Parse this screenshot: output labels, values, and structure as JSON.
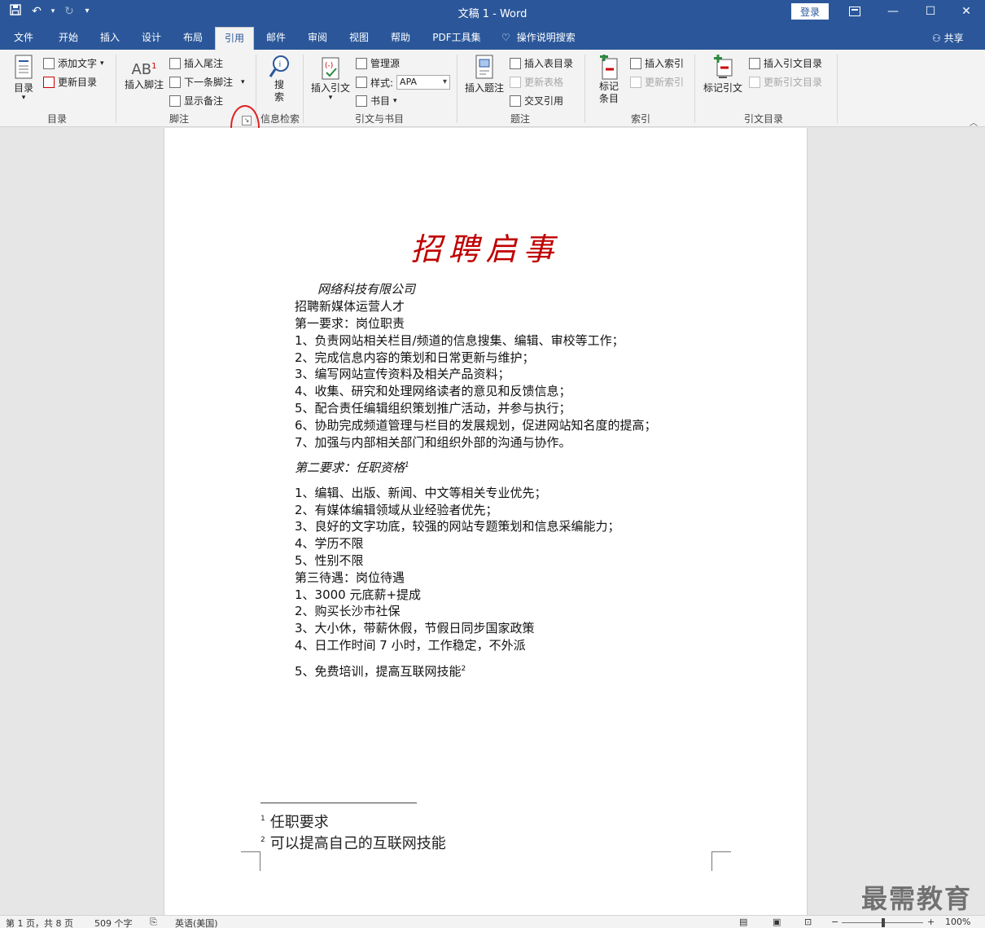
{
  "app": {
    "window_title": "文稿 1  -  Word",
    "login_label": "登录"
  },
  "tabs": [
    {
      "label": "文件"
    },
    {
      "label": "开始"
    },
    {
      "label": "插入"
    },
    {
      "label": "设计"
    },
    {
      "label": "布局"
    },
    {
      "label": "引用"
    },
    {
      "label": "邮件"
    },
    {
      "label": "审阅"
    },
    {
      "label": "视图"
    },
    {
      "label": "帮助"
    },
    {
      "label": "PDF工具集"
    },
    {
      "label": "操作说明搜索"
    }
  ],
  "share_label": "共享",
  "ribbon": {
    "toc": {
      "big": "目录",
      "add_text": "添加文字",
      "update": "更新目录",
      "group": "目录"
    },
    "footnotes": {
      "insert_footnote": "插入脚注",
      "insert_endnote": "插入尾注",
      "next_footnote": "下一条脚注",
      "show_notes": "显示备注",
      "group": "脚注"
    },
    "research": {
      "search": "搜索",
      "group": "信息检索"
    },
    "citations": {
      "insert_citation": "插入引文",
      "manage_sources": "管理源",
      "style_label": "样式:",
      "style_value": "APA",
      "bibliography": "书目",
      "group": "引文与书目"
    },
    "captions": {
      "insert_caption": "插入题注",
      "insert_table_of_figures": "插入表目录",
      "update_table": "更新表格",
      "cross_reference": "交叉引用",
      "group": "题注"
    },
    "index": {
      "mark_entry": "标记条目",
      "insert_index": "插入索引",
      "update_index": "更新索引",
      "group": "索引"
    },
    "toa": {
      "mark_citation": "标记引文",
      "insert_toa": "插入引文目录",
      "update_toa": "更新引文目录",
      "group": "引文目录"
    }
  },
  "document": {
    "title": "招聘启事",
    "lines": [
      "网络科技有限公司",
      "招聘新媒体运营人才",
      "第一要求：岗位职责",
      "1、负责网站相关栏目/频道的信息搜集、编辑、审校等工作；",
      "2、完成信息内容的策划和日常更新与维护；",
      "3、编写网站宣传资料及相关产品资料；",
      "4、收集、研究和处理网络读者的意见和反馈信息；",
      "5、配合责任编辑组织策划推广活动，并参与执行；",
      "6、协助完成频道管理与栏目的发展规划，促进网站知名度的提高；",
      "7、加强与内部相关部门和组织外部的沟通与协作。",
      "第二要求：任职资格",
      "1、编辑、出版、新闻、中文等相关专业优先；",
      "2、有媒体编辑领域从业经验者优先；",
      "3、良好的文字功底，较强的网站专题策划和信息采编能力；",
      "4、学历不限",
      "5、性别不限",
      "第三待遇：岗位待遇",
      "1、3000 元底薪+提成",
      "2、购买长沙市社保",
      "3、大小休，带薪休假，节假日同步国家政策",
      "4、日工作时间 7 小时，工作稳定，不外派",
      "5、免费培训，提高互联网技能"
    ],
    "footnote_marks": [
      "1",
      "2"
    ],
    "footnotes": [
      {
        "num": "1",
        "text": "任职要求"
      },
      {
        "num": "2",
        "text": "可以提高自己的互联网技能"
      }
    ]
  },
  "status": {
    "page": "第 1 页，共 8 页",
    "words": "509 个字",
    "language": "英语(美国)",
    "zoom": "100%"
  },
  "watermark": "最需教育"
}
